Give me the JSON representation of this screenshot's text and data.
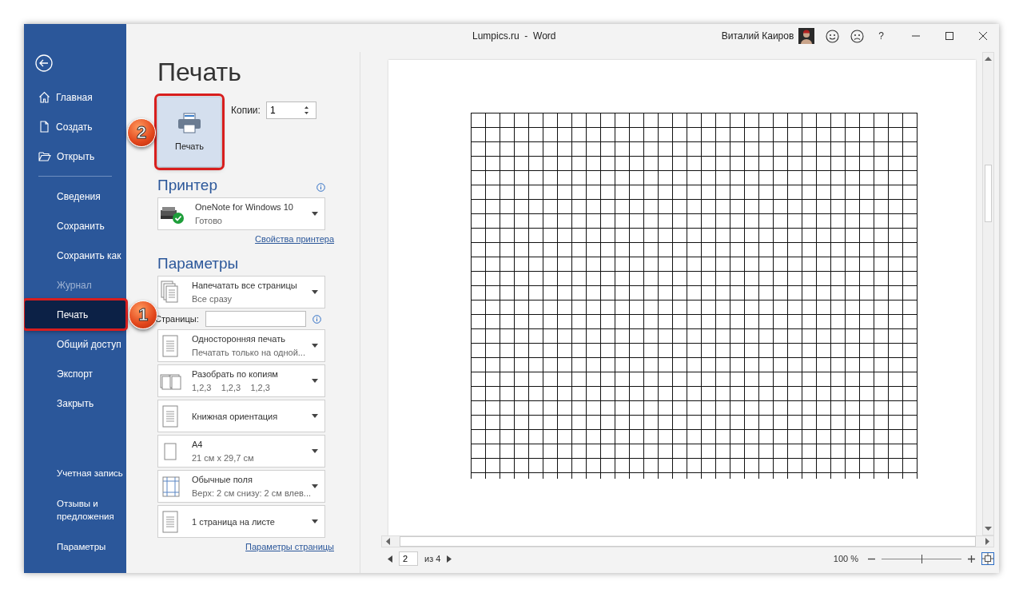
{
  "window": {
    "title": "Lumpics.ru  -  Word",
    "user": "Виталий Каиров",
    "help": "?"
  },
  "sidebar": {
    "top_items": [
      {
        "label": "Главная",
        "selected": false
      },
      {
        "label": "Создать",
        "selected": false
      },
      {
        "label": "Открыть",
        "selected": false
      }
    ],
    "middle_items": [
      {
        "label": "Сведения",
        "selected": false,
        "disabled": false,
        "highlighted": false
      },
      {
        "label": "Сохранить",
        "selected": false,
        "disabled": false,
        "highlighted": false
      },
      {
        "label": "Сохранить как",
        "selected": false,
        "disabled": false,
        "highlighted": false
      },
      {
        "label": "Журнал",
        "selected": false,
        "disabled": true,
        "highlighted": false
      },
      {
        "label": "Печать",
        "selected": true,
        "disabled": false,
        "highlighted": true,
        "callout": "1"
      },
      {
        "label": "Общий доступ",
        "selected": false,
        "disabled": false,
        "highlighted": false
      },
      {
        "label": "Экспорт",
        "selected": false,
        "disabled": false,
        "highlighted": false
      },
      {
        "label": "Закрыть",
        "selected": false,
        "disabled": false,
        "highlighted": false
      }
    ],
    "bottom_items": [
      {
        "label": "Учетная запись",
        "selected": false
      },
      {
        "label": "Отзывы и предложения",
        "selected": false
      },
      {
        "label": "Параметры",
        "selected": false
      }
    ]
  },
  "page_title": "Печать",
  "print_button": {
    "label": "Печать",
    "highlighted": true,
    "callout": "2"
  },
  "copies": {
    "label": "Копии:",
    "value": "1"
  },
  "printer": {
    "heading": "Принтер",
    "name": "OneNote for Windows 10",
    "status": "Готово",
    "link": "Свойства принтера"
  },
  "settings": {
    "heading": "Параметры",
    "items": [
      {
        "kind": "dropdown",
        "title": "Напечатать все страницы",
        "subtitle": "Все сразу"
      },
      {
        "kind": "field",
        "label": "Страницы:"
      },
      {
        "kind": "dropdown",
        "title": "Односторонняя печать",
        "subtitle": "Печатать только на одной..."
      },
      {
        "kind": "dropdown",
        "title": "Разобрать по копиям",
        "subtitle": "1,2,3    1,2,3    1,2,3"
      },
      {
        "kind": "dropdown",
        "title": "Книжная ориентация"
      },
      {
        "kind": "dropdown",
        "title": "A4",
        "subtitle": "21 см x 29,7 см"
      },
      {
        "kind": "dropdown",
        "title": "Обычные поля",
        "subtitle": "Верх: 2 см снизу: 2 см влев..."
      },
      {
        "kind": "dropdown",
        "title": "1 страница на листе"
      }
    ],
    "link": "Параметры страницы"
  },
  "preview": {
    "page": "2",
    "page_total": "из 4",
    "zoom": {
      "reading": "100 %",
      "level": 0.5
    }
  }
}
